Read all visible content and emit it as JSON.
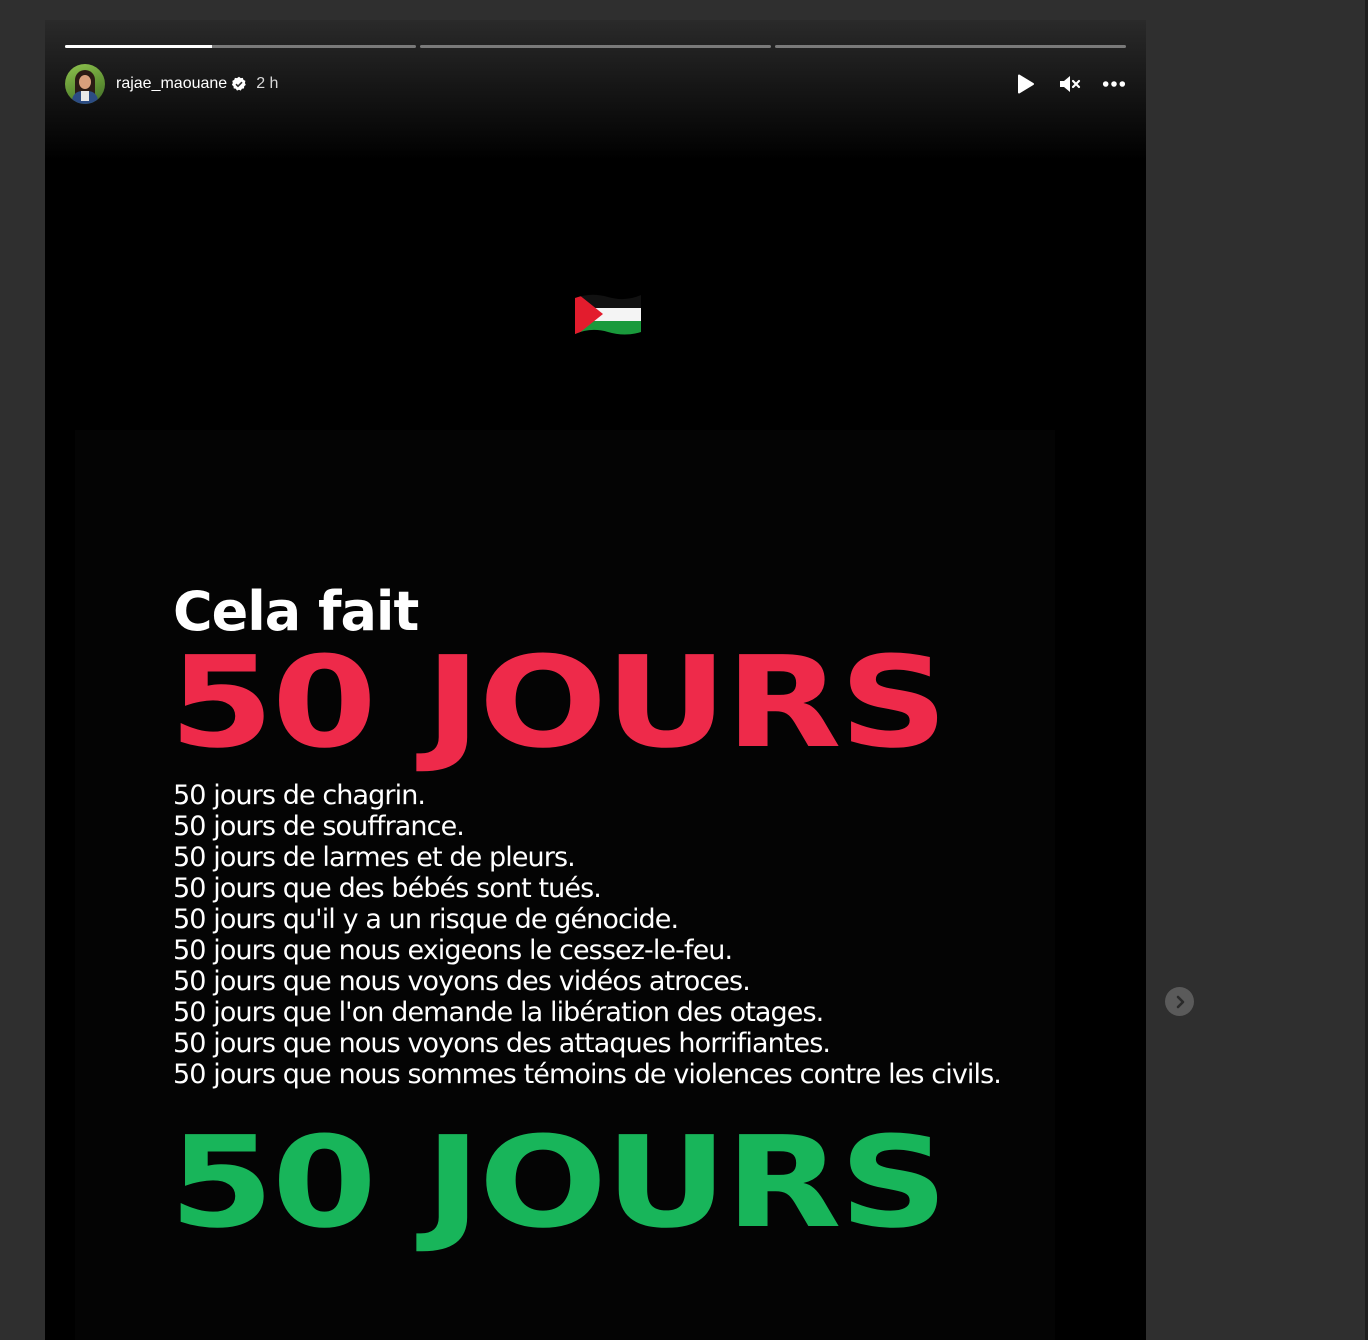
{
  "story": {
    "progress": [
      0.42,
      0,
      0
    ],
    "user": {
      "username": "rajae_maouane",
      "verified": true,
      "time": "2 h"
    },
    "controls": {
      "play_icon": "play-icon",
      "mute_icon": "muted-speaker-icon",
      "more_icon": "more-options-icon"
    },
    "flag_emoji": "palestine-flag",
    "poster": {
      "intro": "Cela fait",
      "headline_top": "50 JOURS",
      "headline_bottom": "50 JOURS",
      "lines": [
        "50 jours de chagrin.",
        "50 jours de souffrance.",
        "50 jours de larmes et de pleurs.",
        "50 jours que des bébés sont tués.",
        "50 jours qu'il y a un risque de génocide.",
        "50 jours que nous exigeons le cessez-le-feu.",
        "50 jours que nous voyons des vidéos atroces.",
        "50 jours que l'on demande la libération des otages.",
        "50 jours que nous voyons des attaques horrifiantes.",
        "50 jours que nous sommes témoins de violences contre les civils."
      ],
      "colors": {
        "red": "#ee2a4a",
        "green": "#18b55a"
      }
    }
  },
  "navigation": {
    "next_icon": "chevron-right-icon"
  }
}
